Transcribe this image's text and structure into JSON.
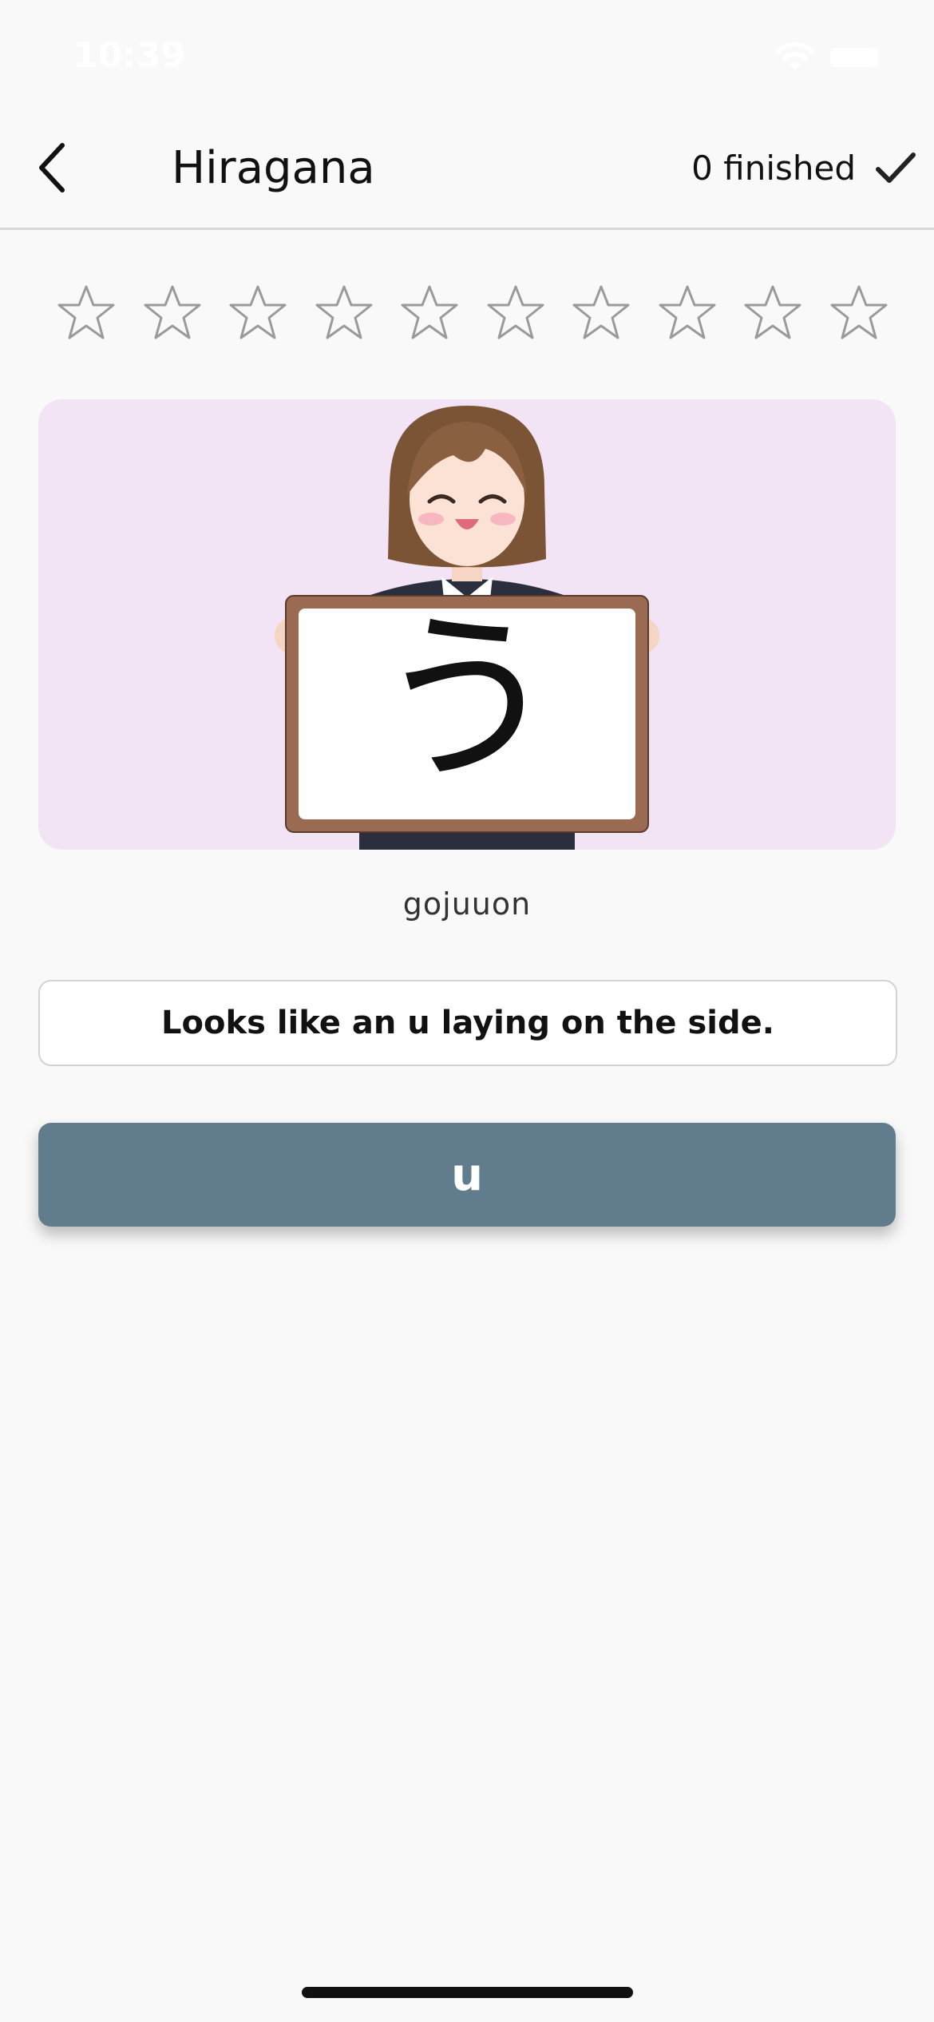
{
  "status_bar": {
    "time": "10:39"
  },
  "nav": {
    "title": "Hiragana",
    "finished_text": "0 finished"
  },
  "stars": {
    "total": 10,
    "filled": 0
  },
  "card": {
    "kana": "う",
    "background": "#f2e4f5"
  },
  "kana_group": "gojuuon",
  "hint": "Looks like an u laying on the side.",
  "answer_button": {
    "label": "u",
    "color": "#617d8d"
  },
  "icons": {
    "back": "chevron-left-icon",
    "done": "checkmark-icon",
    "star": "star-outline-icon",
    "wifi": "wifi-icon",
    "battery": "battery-icon"
  }
}
